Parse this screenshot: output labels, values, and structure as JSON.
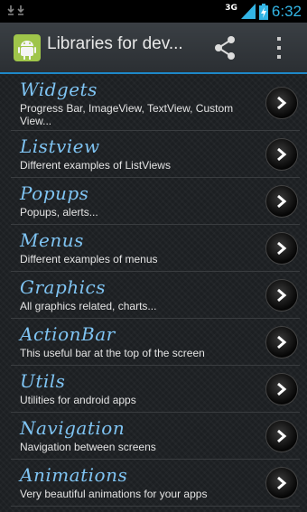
{
  "status_bar": {
    "network": "3G",
    "time": "6:32",
    "icons": [
      "download-icon",
      "signal-icon",
      "battery-charging-icon"
    ]
  },
  "action_bar": {
    "title": "Libraries for dev...",
    "icons": [
      "android-app-icon",
      "share-icon",
      "overflow-menu-icon"
    ]
  },
  "colors": {
    "accent": "#33b5e5",
    "title_text": "#7fc4f3",
    "actionbar_underline": "#1e88c8"
  },
  "list": {
    "items": [
      {
        "title": "Widgets",
        "subtitle": "Progress Bar, ImageView, TextView, Custom View..."
      },
      {
        "title": "Listview",
        "subtitle": "Different examples of ListViews"
      },
      {
        "title": "Popups",
        "subtitle": "Popups, alerts..."
      },
      {
        "title": "Menus",
        "subtitle": "Different examples of menus"
      },
      {
        "title": "Graphics",
        "subtitle": "All graphics related, charts..."
      },
      {
        "title": "ActionBar",
        "subtitle": "This useful bar at the top of the screen"
      },
      {
        "title": "Utils",
        "subtitle": "Utilities for android apps"
      },
      {
        "title": "Navigation",
        "subtitle": "Navigation between screens"
      },
      {
        "title": "Animations",
        "subtitle": "Very beautiful animations for your apps"
      }
    ]
  }
}
